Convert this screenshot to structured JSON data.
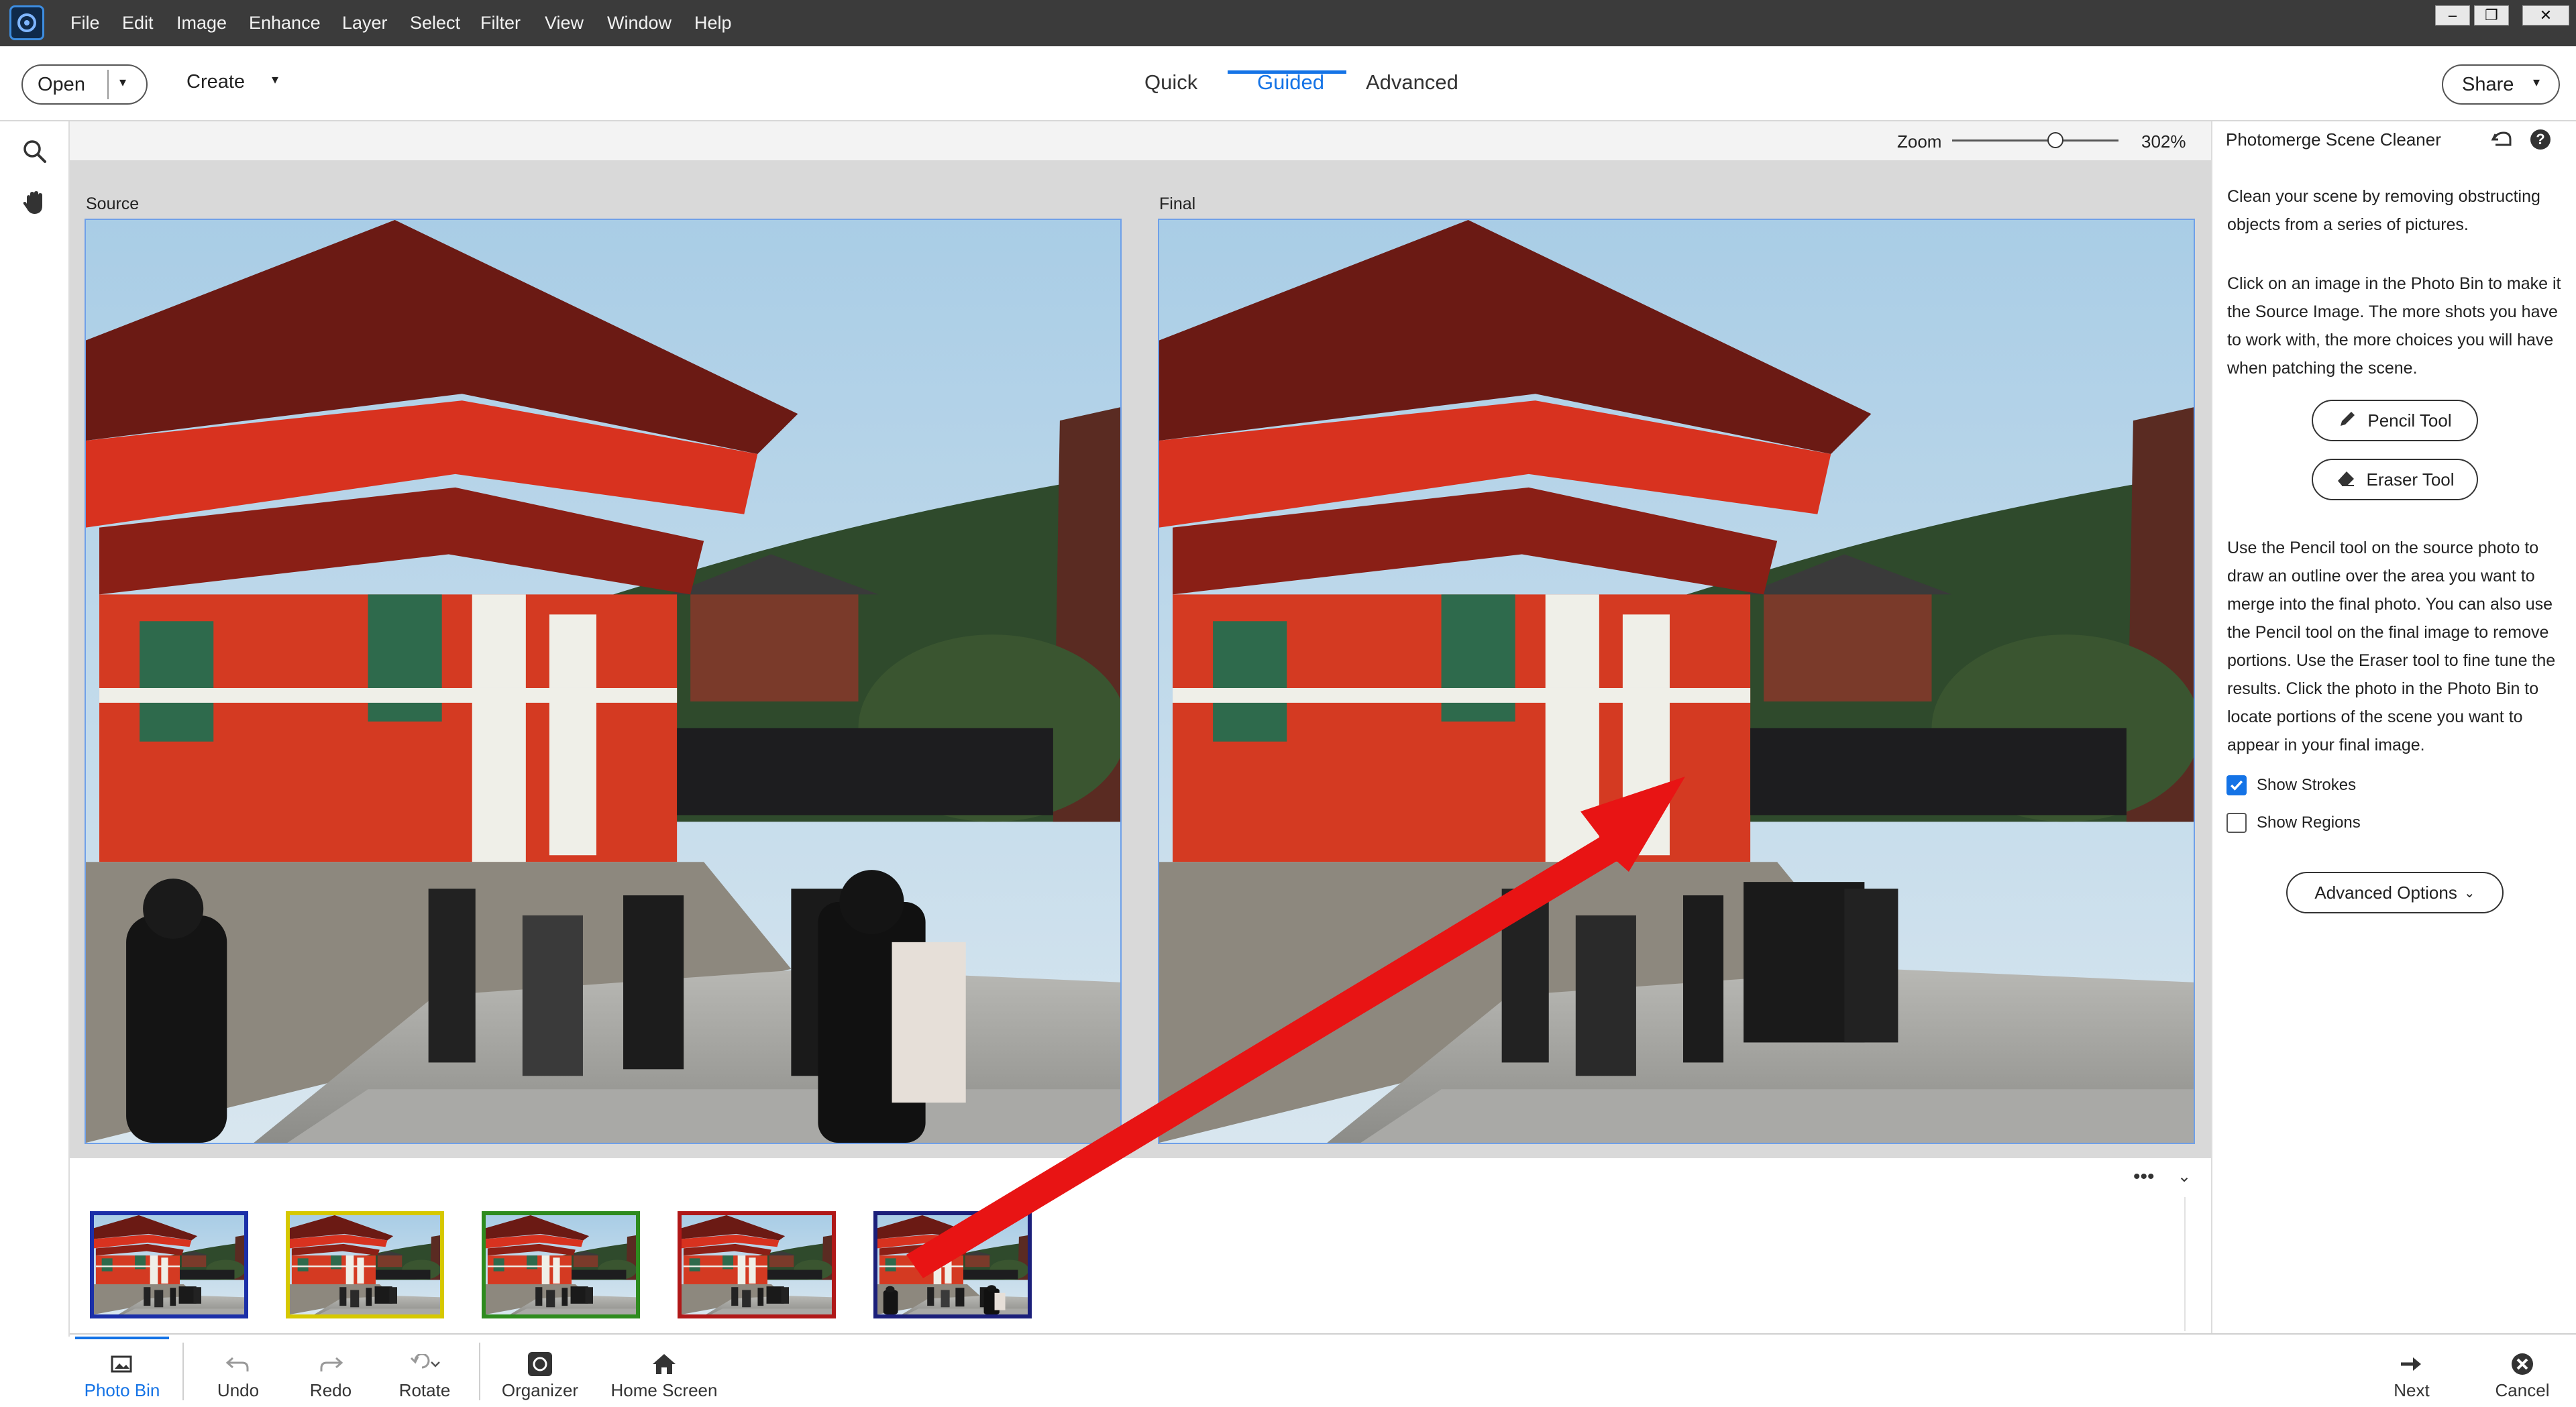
{
  "app": {
    "menu": [
      "File",
      "Edit",
      "Image",
      "Enhance",
      "Layer",
      "Select",
      "Filter",
      "View",
      "Window",
      "Help"
    ],
    "window_controls": [
      "minimize",
      "restore",
      "close"
    ]
  },
  "modebar": {
    "open_label": "Open",
    "create_label": "Create",
    "tabs": [
      {
        "label": "Quick",
        "active": false
      },
      {
        "label": "Guided",
        "active": true
      },
      {
        "label": "Advanced",
        "active": false
      }
    ],
    "share_label": "Share"
  },
  "toolstrip": {
    "tools": [
      "zoom-icon",
      "hand-icon"
    ]
  },
  "zoom": {
    "label": "Zoom",
    "value_text": "302%",
    "slider_fraction": 0.62
  },
  "canvas": {
    "source_label": "Source",
    "final_label": "Final"
  },
  "photo_bin": {
    "thumb_border_colors": [
      "#1b2fa8",
      "#d6c800",
      "#2e8b1e",
      "#b01818",
      "#1b1f7a"
    ]
  },
  "taskbar": {
    "items": [
      {
        "label": "Photo Bin",
        "icon": "photo-bin-icon",
        "active": true
      },
      {
        "label": "Undo",
        "icon": "undo-icon",
        "active": false
      },
      {
        "label": "Redo",
        "icon": "redo-icon",
        "active": false
      },
      {
        "label": "Rotate",
        "icon": "rotate-icon",
        "active": false
      },
      {
        "label": "Organizer",
        "icon": "organizer-icon",
        "active": false
      },
      {
        "label": "Home Screen",
        "icon": "home-icon",
        "active": false
      }
    ],
    "next_label": "Next",
    "cancel_label": "Cancel"
  },
  "panel": {
    "title": "Photomerge Scene Cleaner",
    "intro": "Clean your scene by removing obstructing objects from a series of pictures.",
    "instructions": "Click on an image in the Photo Bin to make it the Source Image. The more shots you have to work with, the more choices you will have when patching the scene.",
    "pencil_label": "Pencil Tool",
    "eraser_label": "Eraser Tool",
    "details": "Use the Pencil tool on the source photo to draw an outline over the area you want to merge into the final photo. You can also use the Pencil tool on the final image to remove portions. Use the Eraser tool to fine tune the results. Click the photo in the Photo Bin to locate portions of the scene you want to appear in your final image.",
    "show_strokes_label": "Show Strokes",
    "show_strokes_checked": true,
    "show_regions_label": "Show Regions",
    "show_regions_checked": false,
    "advanced_label": "Advanced Options"
  },
  "colors": {
    "accent": "#1473e6",
    "menubar": "#3b3b3b",
    "annotation_arrow": "#e81414"
  }
}
